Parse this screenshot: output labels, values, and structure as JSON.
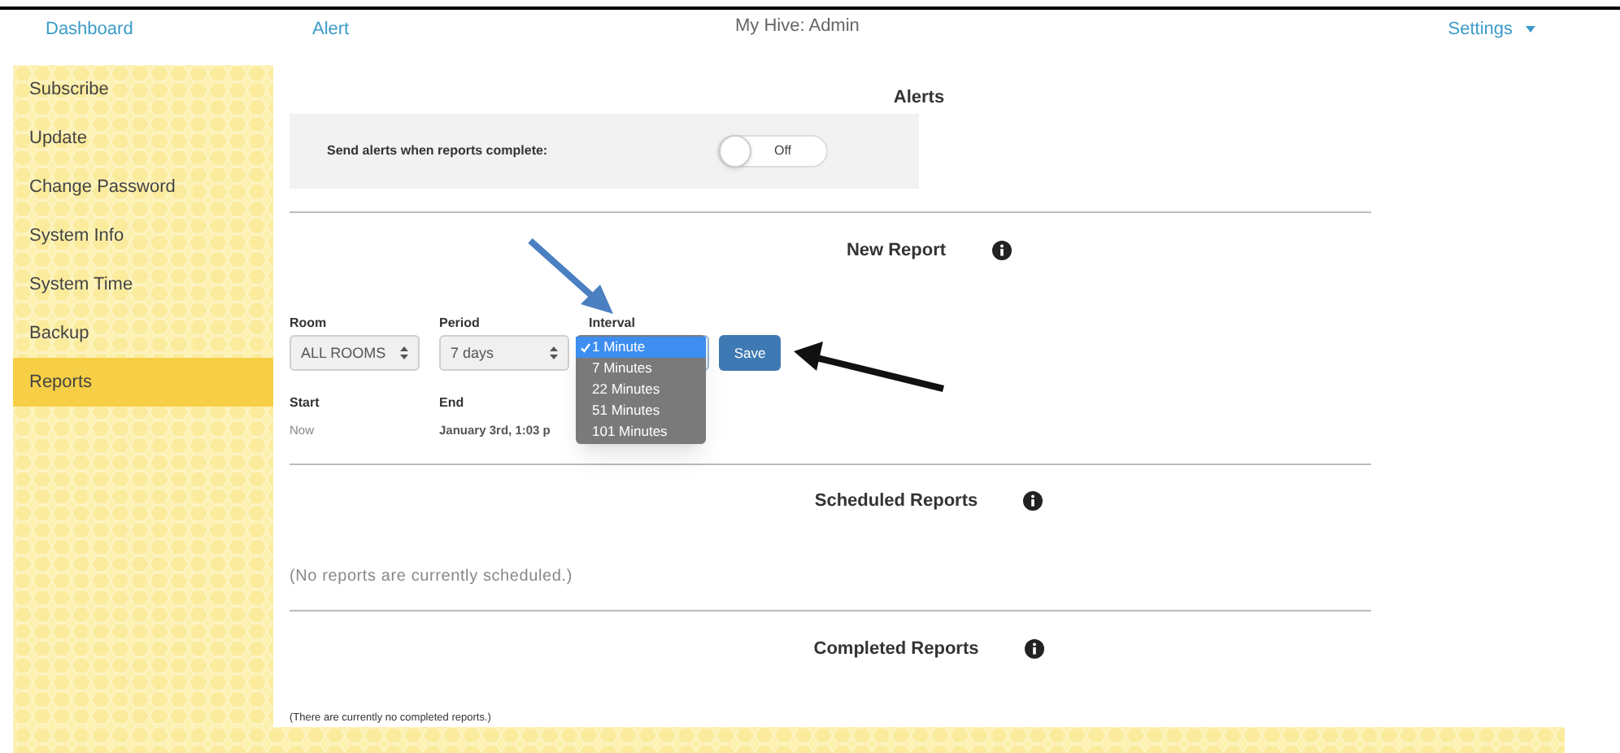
{
  "nav": {
    "links": [
      {
        "label": "Dashboard"
      },
      {
        "label": "Alert"
      }
    ],
    "title": "My Hive: Admin",
    "settings": {
      "label": "Settings"
    }
  },
  "sidebar": {
    "items": [
      {
        "label": "Subscribe",
        "selected": false
      },
      {
        "label": "Update",
        "selected": false
      },
      {
        "label": "Change Password",
        "selected": false
      },
      {
        "label": "System Info",
        "selected": false
      },
      {
        "label": "System Time",
        "selected": false
      },
      {
        "label": "Backup",
        "selected": false
      },
      {
        "label": "Reports",
        "selected": true
      }
    ]
  },
  "alerts": {
    "title": "Alerts",
    "label": "Send alerts when reports complete:",
    "toggle": {
      "on": false,
      "label": "Off"
    }
  },
  "new_report": {
    "title": "New Report",
    "room": {
      "label": "Room",
      "value": "ALL ROOMS"
    },
    "period": {
      "label": "Period",
      "value": "7 days"
    },
    "interval": {
      "label": "Interval",
      "options": [
        {
          "label": "1 Minute",
          "selected": true
        },
        {
          "label": "7 Minutes",
          "selected": false
        },
        {
          "label": "22 Minutes",
          "selected": false
        },
        {
          "label": "51 Minutes",
          "selected": false
        },
        {
          "label": "101 Minutes",
          "selected": false
        }
      ]
    },
    "save": "Save",
    "start": {
      "label": "Start",
      "value": "Now"
    },
    "end": {
      "label": "End",
      "value": "January 3rd, 1:03 p"
    }
  },
  "scheduled": {
    "title": "Scheduled Reports",
    "empty": "(No reports are currently scheduled.)"
  },
  "completed": {
    "title": "Completed Reports",
    "empty": "(There are currently no completed reports.)"
  },
  "annotations": [
    {
      "color": "#4a7fc1"
    },
    {
      "color": "#111111"
    }
  ]
}
